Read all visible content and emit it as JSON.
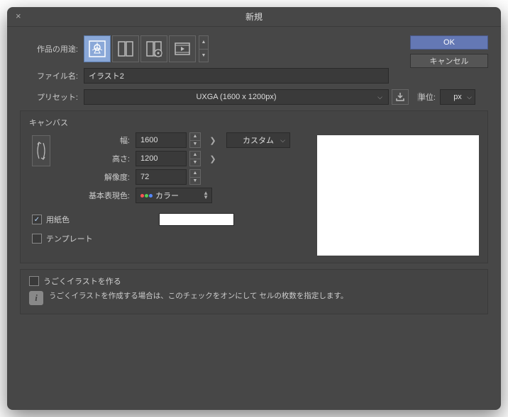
{
  "title": "新規",
  "buttons": {
    "ok": "OK",
    "cancel": "キャンセル"
  },
  "labels": {
    "purpose": "作品の用途:",
    "filename": "ファイル名:",
    "preset": "プリセット:",
    "unit": "単位:"
  },
  "filename": "イラスト2",
  "preset": "UXGA (1600 x 1200px)",
  "unit": "px",
  "canvas": {
    "title": "キャンバス",
    "width_label": "幅:",
    "height_label": "高さ:",
    "resolution_label": "解像度:",
    "colormode_label": "基本表現色:",
    "width": "1600",
    "height": "1200",
    "resolution": "72",
    "custom": "カスタム",
    "colormode": "カラー"
  },
  "papercolor": {
    "label": "用紙色",
    "checked": true,
    "value": "#ffffff"
  },
  "template": {
    "label": "テンプレート",
    "checked": false
  },
  "anim": {
    "label": "うごくイラストを作る",
    "checked": false,
    "info": "うごくイラストを作成する場合は、このチェックをオンにして\nセルの枚数を指定します。"
  },
  "icons": {
    "purpose1": "illustration-icon",
    "purpose2": "comic-icon",
    "purpose3": "comic-settings-icon",
    "purpose4": "animation-icon"
  }
}
